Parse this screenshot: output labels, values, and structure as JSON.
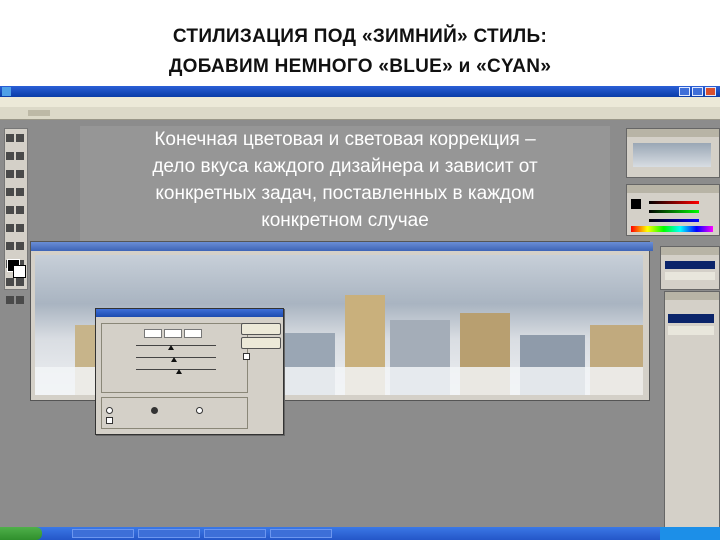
{
  "slide": {
    "title_line1": "СТИЛИЗАЦИЯ ПОД «ЗИМНИЙ» СТИЛЬ:",
    "title_line2": "ДОБАВИМ НЕМНОГО  «BLUE» и «CYAN»"
  },
  "overlay": {
    "line1": "Конечная цветовая и световая коррекция –",
    "line2": "дело вкуса  каждого дизайнера и зависит от",
    "line3": "конкретных задач,  поставленных в каждом",
    "line4": "конкретном случае"
  },
  "colors": {
    "window_title_blue": "#0a3ca8",
    "workspace_gray": "#8c8c8c",
    "overlay_panel": "#969696",
    "taskbar_blue": "#2456c8",
    "start_green": "#2f8f2c"
  },
  "icons": [
    "photoshop-icon",
    "minimize-icon",
    "maximize-icon",
    "close-icon",
    "foreground-color-swatch",
    "background-color-swatch"
  ]
}
